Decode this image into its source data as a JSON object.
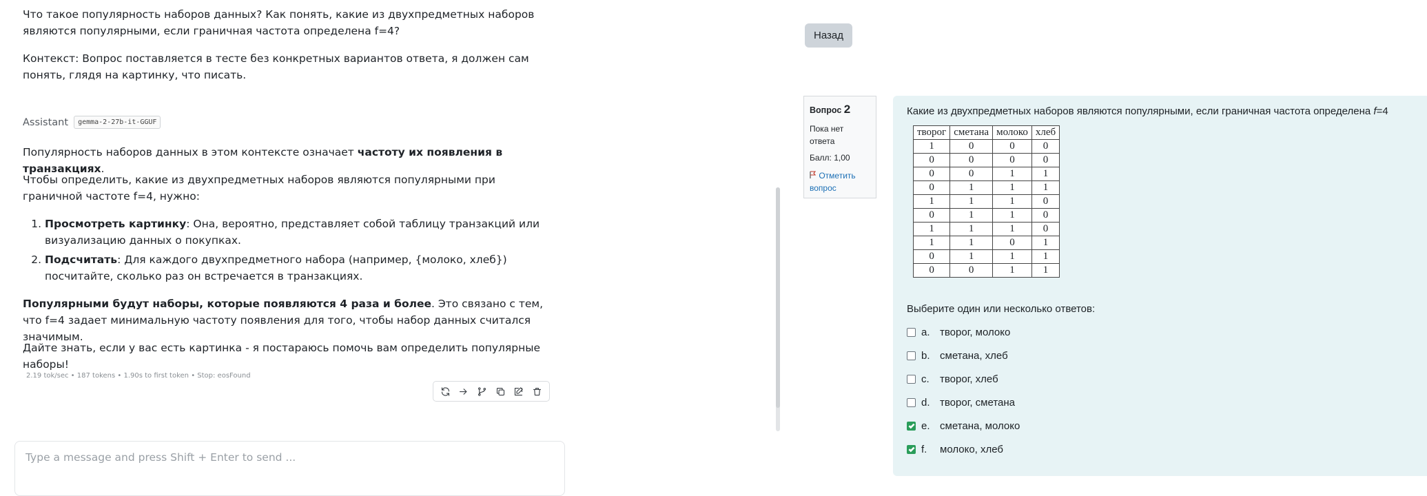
{
  "chat": {
    "user_message": {
      "paragraph1": "Что такое популярность наборов данных? Как понять, какие из двухпредметных наборов являются популярными, если граничная частота определена f=4?",
      "paragraph2": "Контекст: Вопрос поставляется в тесте без конкретных вариантов ответа, я должен сам понять, глядя на картинку, что писать."
    },
    "assistant": {
      "name": "Assistant",
      "model": "gemma-2-27b-it-GGUF",
      "p1_pre": "Популярность наборов данных в этом контексте означает ",
      "p1_bold": "частоту их появления в транзакциях",
      "p1_post": ".",
      "p2": "Чтобы определить, какие из двухпредметных наборов являются популярными при граничной частоте f=4, нужно:",
      "steps": [
        {
          "bold": "Просмотреть картинку",
          "text": ": Она, вероятно, представляет собой таблицу транзакций или визуализацию данных о покупках."
        },
        {
          "bold": "Подсчитать",
          "text": ": Для каждого двухпредметного набора (например, {молоко, хлеб}) посчитайте, сколько раз он встречается в транзакциях."
        }
      ],
      "p3_bold": "Популярными будут наборы, которые появляются 4 раза и более",
      "p3_rest": ".  Это связано с тем, что f=4 задает минимальную частоту появления для того, чтобы набор данных считался значимым.",
      "p4": "Дайте знать, если у вас есть картинка - я постараюсь помочь вам определить популярные наборы!",
      "stats": "2.19 tok/sec  •  187 tokens  •  1.90s to first token  •  Stop: eosFound"
    },
    "actions": [
      "refresh-icon",
      "continue-icon",
      "branch-icon",
      "copy-icon",
      "edit-icon",
      "delete-icon"
    ],
    "composer_placeholder": "Type a message and press Shift + Enter to send ..."
  },
  "quiz": {
    "back_label": "Назад",
    "question_label": "Вопрос",
    "question_number": "2",
    "state": "Пока нет ответа",
    "grade": "Балл: 1,00",
    "flag_label": "Отметить вопрос",
    "question_pre": "Какие из двухпредметных наборов являются популярными, если граничная частота определена ",
    "question_var": "f",
    "question_post": "=4",
    "table": {
      "headers": [
        "творог",
        "сметана",
        "молоко",
        "хлеб"
      ],
      "rows": [
        [
          "1",
          "0",
          "0",
          "0"
        ],
        [
          "0",
          "0",
          "0",
          "0"
        ],
        [
          "0",
          "0",
          "1",
          "1"
        ],
        [
          "0",
          "1",
          "1",
          "1"
        ],
        [
          "1",
          "1",
          "1",
          "0"
        ],
        [
          "0",
          "1",
          "1",
          "0"
        ],
        [
          "1",
          "1",
          "1",
          "0"
        ],
        [
          "1",
          "1",
          "0",
          "1"
        ],
        [
          "0",
          "1",
          "1",
          "1"
        ],
        [
          "0",
          "0",
          "1",
          "1"
        ]
      ]
    },
    "prompt": "Выберите один или несколько ответов:",
    "answers": [
      {
        "letter": "a.",
        "text": "творог, молоко",
        "checked": false
      },
      {
        "letter": "b.",
        "text": "сметана, хлеб",
        "checked": false
      },
      {
        "letter": "c.",
        "text": "творог, хлеб",
        "checked": false
      },
      {
        "letter": "d.",
        "text": "творог, сметана",
        "checked": false
      },
      {
        "letter": "e.",
        "text": "сметана, молоко",
        "checked": true
      },
      {
        "letter": "f.",
        "text": "молоко, хлеб",
        "checked": true
      }
    ],
    "colors": {
      "checked": "#2a9d5a",
      "panel": "#e7f3f5",
      "link": "#1b6fb5"
    }
  }
}
